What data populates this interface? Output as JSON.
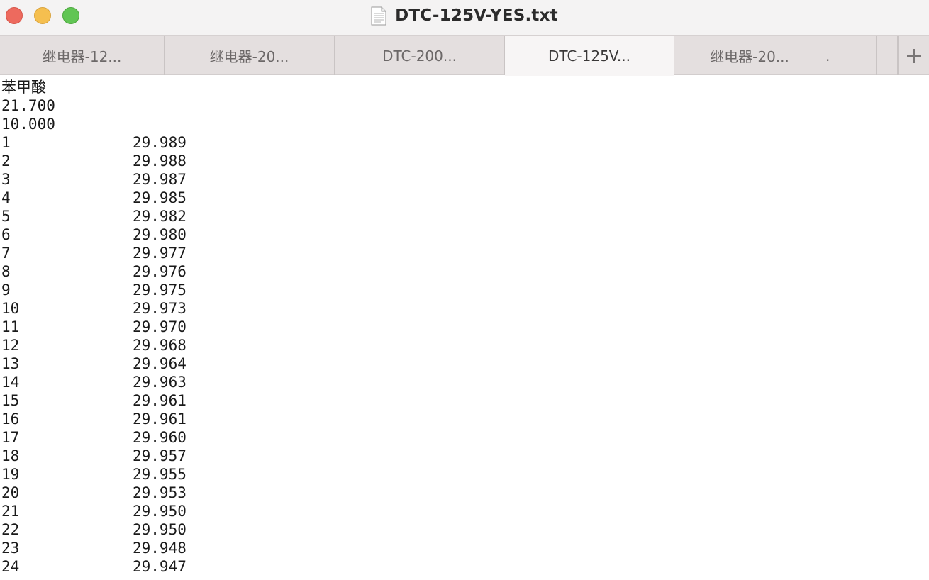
{
  "window": {
    "title": "DTC-125V-YES.txt",
    "controls": {
      "close_color": "#ed6a5e",
      "minimize_color": "#f5bf4f",
      "zoom_color": "#61c554"
    },
    "doc_icon": "text-document-icon"
  },
  "tabs": [
    {
      "label": "继电器-12..."
    },
    {
      "label": "继电器-20..."
    },
    {
      "label": "DTC-200..."
    },
    {
      "label": "DTC-125V...",
      "active": true
    },
    {
      "label": "继电器-20..."
    },
    {
      "label": "."
    },
    {
      "label": ""
    }
  ],
  "new_tab_icon": "plus-icon",
  "document": {
    "header_lines": [
      "苯甲酸",
      "21.700",
      "10.000"
    ],
    "rows": [
      {
        "index": "1",
        "value": "29.989"
      },
      {
        "index": "2",
        "value": "29.988"
      },
      {
        "index": "3",
        "value": "29.987"
      },
      {
        "index": "4",
        "value": "29.985"
      },
      {
        "index": "5",
        "value": "29.982"
      },
      {
        "index": "6",
        "value": "29.980"
      },
      {
        "index": "7",
        "value": "29.977"
      },
      {
        "index": "8",
        "value": "29.976"
      },
      {
        "index": "9",
        "value": "29.975"
      },
      {
        "index": "10",
        "value": "29.973"
      },
      {
        "index": "11",
        "value": "29.970"
      },
      {
        "index": "12",
        "value": "29.968"
      },
      {
        "index": "13",
        "value": "29.964"
      },
      {
        "index": "14",
        "value": "29.963"
      },
      {
        "index": "15",
        "value": "29.961"
      },
      {
        "index": "16",
        "value": "29.961"
      },
      {
        "index": "17",
        "value": "29.960"
      },
      {
        "index": "18",
        "value": "29.957"
      },
      {
        "index": "19",
        "value": "29.955"
      },
      {
        "index": "20",
        "value": "29.953"
      },
      {
        "index": "21",
        "value": "29.950"
      },
      {
        "index": "22",
        "value": "29.950"
      },
      {
        "index": "23",
        "value": "29.948"
      },
      {
        "index": "24",
        "value": "29.947"
      }
    ]
  }
}
